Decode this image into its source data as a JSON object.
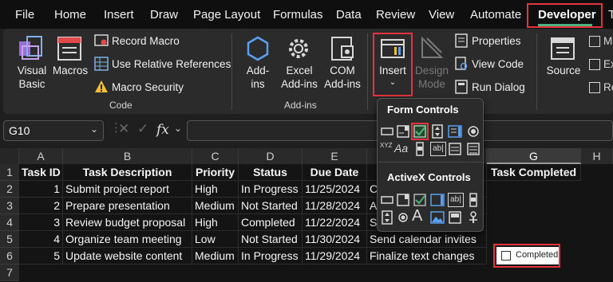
{
  "menu": {
    "tabs": [
      "File",
      "Home",
      "Insert",
      "Draw",
      "Page Layout",
      "Formulas",
      "Data",
      "Review",
      "View",
      "Automate",
      "Developer",
      "T"
    ],
    "active": "Developer"
  },
  "ribbon": {
    "code": {
      "label": "Code",
      "visual_basic": "Visual\nBasic",
      "visual_basic_1": "Visual",
      "visual_basic_2": "Basic",
      "macros": "Macros",
      "record_macro": "Record Macro",
      "relative_refs": "Use Relative References",
      "macro_security": "Macro Security"
    },
    "addins": {
      "label": "Add-ins",
      "addins_1": "Add-",
      "addins_2": "ins",
      "excel_1": "Excel",
      "excel_2": "Add-ins",
      "com_1": "COM",
      "com_2": "Add-ins"
    },
    "controls": {
      "insert": "Insert",
      "design_1": "Design",
      "design_2": "Mode",
      "properties": "Properties",
      "view_code": "View Code",
      "run_dialog": "Run Dialog"
    },
    "xml": {
      "source": "Source",
      "partial_1": "M",
      "partial_2": "Ex",
      "partial_3": "Re"
    }
  },
  "formula_bar": {
    "name_box": "G10",
    "fx": "fx"
  },
  "dropdown": {
    "form_controls": "Form Controls",
    "activex_controls": "ActiveX Controls",
    "xyz": "XYZ",
    "aa": "Aa",
    "abl": "ab|",
    "a_big": "A"
  },
  "columns": [
    "A",
    "B",
    "C",
    "D",
    "E",
    "F",
    "G",
    "H"
  ],
  "rows": [
    "1",
    "2",
    "3",
    "4",
    "5",
    "6",
    "7"
  ],
  "table": {
    "headers": [
      "Task ID",
      "Task Description",
      "Priority",
      "Status",
      "Due Date",
      "",
      "Task Completed"
    ],
    "rows": [
      [
        "1",
        "Submit project report",
        "High",
        "In Progress",
        "11/25/2024",
        "C"
      ],
      [
        "2",
        "Prepare presentation",
        "Medium",
        "Not Started",
        "11/28/2024",
        "A"
      ],
      [
        "3",
        "Review budget proposal",
        "High",
        "Completed",
        "11/22/2024",
        "S"
      ],
      [
        "4",
        "Organize team meeting",
        "Low",
        "Not Started",
        "11/30/2024",
        "Send calendar invites"
      ],
      [
        "5",
        "Update website content",
        "Medium",
        "In Progress",
        "11/29/2024",
        "Finalize text changes"
      ]
    ]
  },
  "checkbox": {
    "label": "Completed",
    "checked": false
  },
  "colors": {
    "highlight": "#e8333f",
    "accent": "#4fb27c",
    "background": "#1f1f1f"
  }
}
